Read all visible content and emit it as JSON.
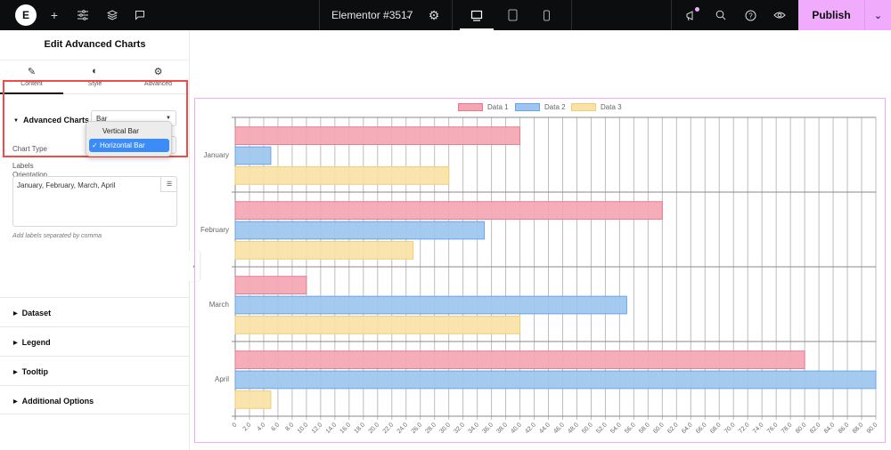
{
  "topbar": {
    "logo_label": "E",
    "document_title": "Elementor #3517",
    "publish_label": "Publish",
    "icons": [
      "elementor-logo-icon",
      "add-icon",
      "settings-sliders-icon",
      "layers-icon",
      "comment-icon",
      "chevron-down-icon",
      "gear-icon",
      "desktop-icon",
      "tablet-icon",
      "mobile-icon",
      "announcement-icon",
      "search-icon",
      "help-icon",
      "preview-eye-icon"
    ],
    "accent_color": "#f0abfc"
  },
  "panel": {
    "title": "Edit Advanced Charts",
    "tabs": [
      {
        "label": "Content",
        "icon": "pencil-icon",
        "active": true
      },
      {
        "label": "Style",
        "icon": "half-circle-icon",
        "active": false
      },
      {
        "label": "Advanced",
        "icon": "gear-icon",
        "active": false
      }
    ],
    "section_title": "Advanced Charts",
    "chart_type_label": "Chart Type",
    "chart_type_value": "Bar",
    "orientation_label": "Orientation",
    "orientation_options": [
      "Vertical Bar",
      "Horizontal Bar"
    ],
    "orientation_selected": "Horizontal Bar",
    "check_mark": "✓",
    "labels_label": "Labels",
    "labels_value": "January, February, March, April",
    "labels_hint": "Add labels separated by comma",
    "accordions": [
      "Dataset",
      "Legend",
      "Tooltip",
      "Additional Options"
    ]
  },
  "chart_data": {
    "type": "bar",
    "orientation": "horizontal",
    "categories": [
      "January",
      "February",
      "March",
      "April"
    ],
    "series": [
      {
        "name": "Data 1",
        "values": [
          40,
          60,
          10,
          80
        ],
        "color": "#f4a7b3",
        "border": "#e87a8c"
      },
      {
        "name": "Data 2",
        "values": [
          5,
          35,
          55,
          90
        ],
        "color": "#9dc5ef",
        "border": "#6aa6e6"
      },
      {
        "name": "Data 3",
        "values": [
          30,
          25,
          40,
          5
        ],
        "color": "#fae2a6",
        "border": "#f1cd74"
      }
    ],
    "xlim": [
      0,
      90
    ],
    "x_tick_step": 2,
    "x_tick_format": "one-decimal",
    "grid": true,
    "legend": "top-center",
    "title": "",
    "xlabel": "",
    "ylabel": ""
  }
}
